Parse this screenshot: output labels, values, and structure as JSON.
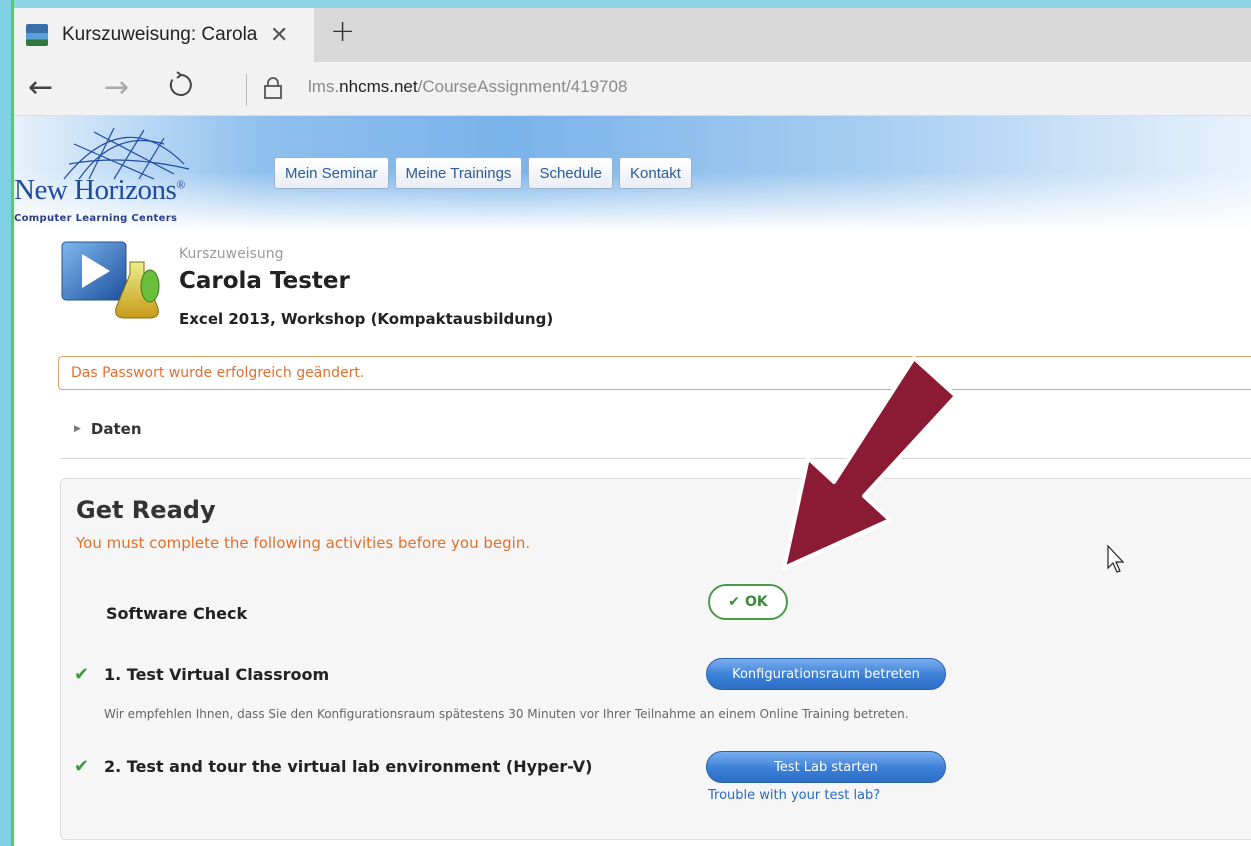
{
  "browser": {
    "tab_title": "Kurszuweisung: Carola T",
    "tab_close": "✕",
    "new_tab": "+",
    "url_prefix": "lms.",
    "url_host": "nhcms.net",
    "url_path": "/CourseAssignment/419708",
    "back_icon": "←",
    "forward_icon": "→",
    "refresh_icon": "↻"
  },
  "logo": {
    "name": "New Horizons",
    "registered": "®",
    "tagline": "Computer Learning Centers"
  },
  "topnav": [
    "Mein Seminar",
    "Meine Trainings",
    "Schedule",
    "Kontakt"
  ],
  "course": {
    "eyebrow": "Kurszuweisung",
    "student_name": "Carola Tester",
    "course_name": "Excel 2013, Workshop (Kompaktausbildung)"
  },
  "alert": {
    "message": "Das Passwort wurde erfolgreich geändert."
  },
  "daten": {
    "caret": "▶",
    "label": "Daten"
  },
  "get_ready": {
    "title": "Get Ready",
    "subtitle": "You must complete the following activities before you begin.",
    "software_check": {
      "label": "Software Check",
      "status_icon": "✔",
      "status": "OK"
    },
    "step1": {
      "check": "✔",
      "label": "1. Test Virtual Classroom",
      "button": "Konfigurationsraum betreten",
      "description": "Wir empfehlen Ihnen, dass Sie den Konfigurationsraum spätestens 30 Minuten vor Ihrer Teilnahme an einem Online Training betreten."
    },
    "step2": {
      "check": "✔",
      "label": "2. Test and tour the virtual lab environment (Hyper-V)",
      "button": "Test Lab starten",
      "link": "Trouble with your test lab?"
    }
  },
  "colors": {
    "accent_orange": "#e0702e",
    "link_blue": "#2a6ac0",
    "success_green": "#3a9a3a",
    "annotation_arrow": "#8b1a34"
  },
  "icons": {
    "favicon": "site-favicon",
    "lock": "lock-icon",
    "course": "course-media-icon",
    "arrow": "annotation-arrow",
    "cursor": "mouse-cursor-icon"
  }
}
